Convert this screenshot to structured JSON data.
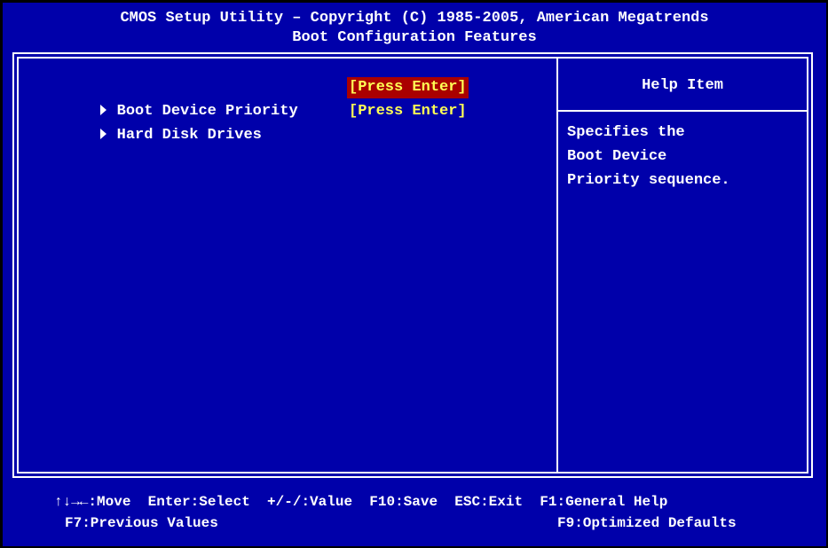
{
  "header": {
    "line1": "CMOS Setup Utility – Copyright (C) 1985-2005, American Megatrends",
    "line2": "Boot Configuration Features"
  },
  "items": [
    {
      "label": "Boot Device Priority",
      "value": "[Press Enter]",
      "selected": true
    },
    {
      "label": "Hard Disk Drives",
      "value": "[Press Enter]",
      "selected": false
    }
  ],
  "help": {
    "title": "Help Item",
    "lines": [
      "Specifies the",
      "Boot Device",
      "Priority sequence."
    ]
  },
  "footer": {
    "line1": "↑↓→←:Move  Enter:Select  +/-/:Value  F10:Save  ESC:Exit  F1:General Help",
    "prev": "F7:Previous Values",
    "defaults": "F9:Optimized Defaults"
  },
  "colors": {
    "background": "#0000aa",
    "text": "#ffffff",
    "value": "#ffff55",
    "selected_bg": "#aa0000"
  }
}
